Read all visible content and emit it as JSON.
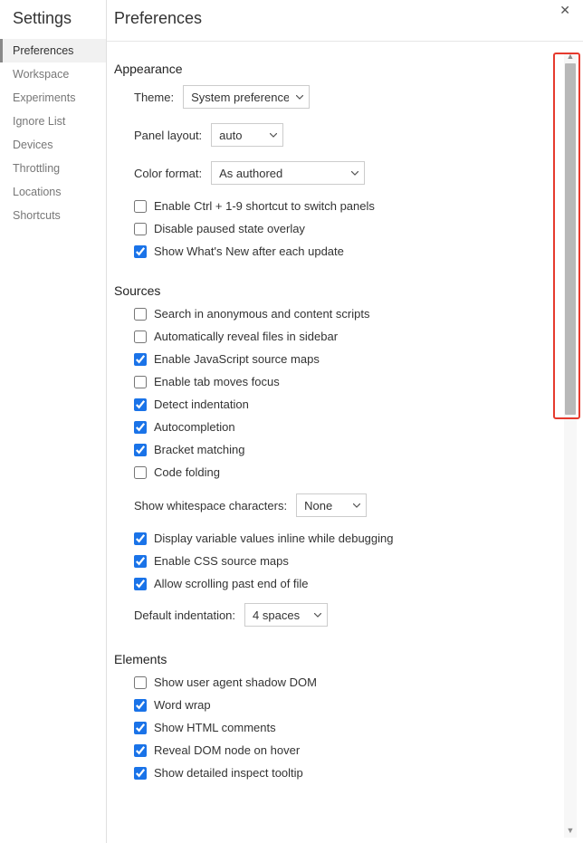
{
  "sidebar": {
    "title": "Settings",
    "items": [
      {
        "label": "Preferences",
        "selected": true
      },
      {
        "label": "Workspace",
        "selected": false
      },
      {
        "label": "Experiments",
        "selected": false
      },
      {
        "label": "Ignore List",
        "selected": false
      },
      {
        "label": "Devices",
        "selected": false
      },
      {
        "label": "Throttling",
        "selected": false
      },
      {
        "label": "Locations",
        "selected": false
      },
      {
        "label": "Shortcuts",
        "selected": false
      }
    ]
  },
  "page": {
    "title": "Preferences"
  },
  "appearance": {
    "heading": "Appearance",
    "theme_label": "Theme:",
    "theme_value": "System preference",
    "panel_layout_label": "Panel layout:",
    "panel_layout_value": "auto",
    "color_format_label": "Color format:",
    "color_format_value": "As authored",
    "checks": [
      {
        "label": "Enable Ctrl + 1-9 shortcut to switch panels",
        "checked": false
      },
      {
        "label": "Disable paused state overlay",
        "checked": false
      },
      {
        "label": "Show What's New after each update",
        "checked": true
      }
    ]
  },
  "sources": {
    "heading": "Sources",
    "checks1": [
      {
        "label": "Search in anonymous and content scripts",
        "checked": false
      },
      {
        "label": "Automatically reveal files in sidebar",
        "checked": false
      },
      {
        "label": "Enable JavaScript source maps",
        "checked": true
      },
      {
        "label": "Enable tab moves focus",
        "checked": false
      },
      {
        "label": "Detect indentation",
        "checked": true
      },
      {
        "label": "Autocompletion",
        "checked": true
      },
      {
        "label": "Bracket matching",
        "checked": true
      },
      {
        "label": "Code folding",
        "checked": false
      }
    ],
    "whitespace_label": "Show whitespace characters:",
    "whitespace_value": "None",
    "checks2": [
      {
        "label": "Display variable values inline while debugging",
        "checked": true
      },
      {
        "label": "Enable CSS source maps",
        "checked": true
      },
      {
        "label": "Allow scrolling past end of file",
        "checked": true
      }
    ],
    "indent_label": "Default indentation:",
    "indent_value": "4 spaces"
  },
  "elements": {
    "heading": "Elements",
    "checks": [
      {
        "label": "Show user agent shadow DOM",
        "checked": false
      },
      {
        "label": "Word wrap",
        "checked": true
      },
      {
        "label": "Show HTML comments",
        "checked": true
      },
      {
        "label": "Reveal DOM node on hover",
        "checked": true
      },
      {
        "label": "Show detailed inspect tooltip",
        "checked": true
      }
    ]
  }
}
